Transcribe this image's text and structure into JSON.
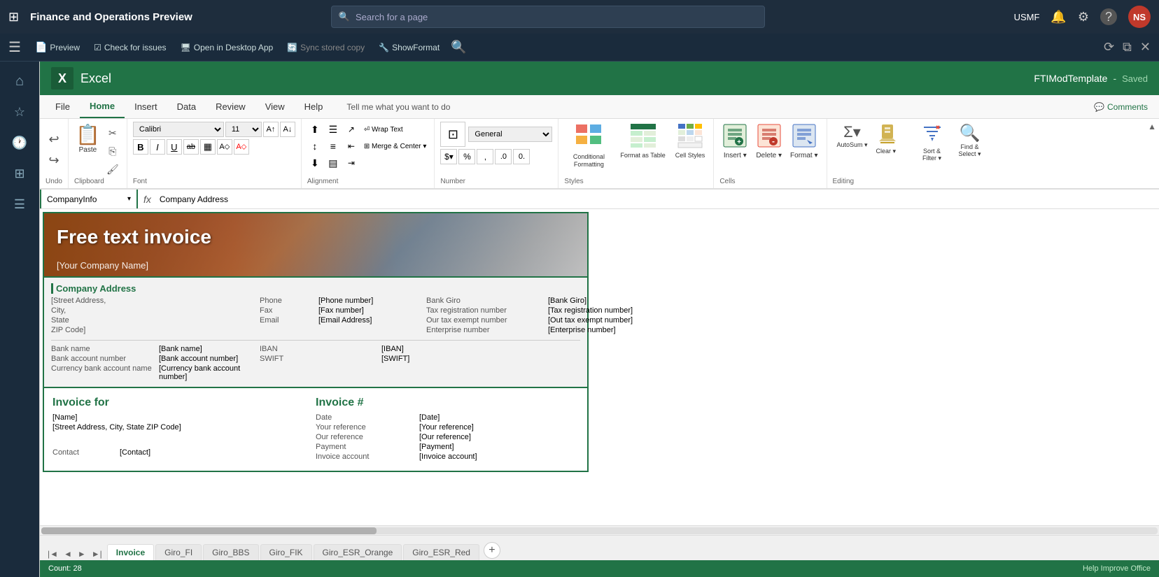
{
  "topNav": {
    "gridIcon": "⊞",
    "title": "Finance and Operations Preview",
    "search": {
      "placeholder": "Search for a page",
      "icon": "🔍"
    },
    "userRegion": "USMF",
    "icons": {
      "bell": "🔔",
      "gear": "⚙",
      "help": "?",
      "avatar": "NS"
    }
  },
  "appToolbar": {
    "preview": "Preview",
    "checkIssues": "Check for issues",
    "openDesktop": "Open in Desktop App",
    "syncCopy": "Sync stored copy",
    "showFormat": "ShowFormat",
    "searchIcon": "🔍"
  },
  "excel": {
    "logo": "X",
    "appName": "Excel",
    "fileName": "FTIModTemplate",
    "separator": "-",
    "savedStatus": "Saved"
  },
  "ribbon": {
    "tabs": [
      "File",
      "Home",
      "Insert",
      "Data",
      "Review",
      "View",
      "Help"
    ],
    "activeTab": "Home",
    "tellMe": "Tell me what you want to do",
    "comments": "Comments",
    "groups": {
      "undo": {
        "label": "Undo",
        "redo": "Redo"
      },
      "clipboard": {
        "label": "Clipboard",
        "paste": "Paste"
      },
      "font": {
        "label": "Font",
        "fontName": "Calibri",
        "fontSize": "11",
        "bold": "B",
        "italic": "I",
        "underline": "U",
        "strikethrough": "ab",
        "increase": "A↑",
        "decrease": "A↓"
      },
      "alignment": {
        "label": "Alignment"
      },
      "number": {
        "label": "Number",
        "format": "General"
      },
      "styles": {
        "label": "Styles",
        "conditional": "Conditional Formatting",
        "formatTable": "Format as Table",
        "cellStyles": "Cell Styles"
      },
      "cells": {
        "label": "Cells",
        "insert": "Insert",
        "delete": "Delete",
        "format": "Format"
      },
      "editing": {
        "label": "Editing",
        "autoSum": "AutoSum",
        "clear": "Clear",
        "sort": "Sort & Filter",
        "find": "Find & Select"
      }
    }
  },
  "formulaBar": {
    "nameBox": "CompanyInfo",
    "formula": "Company Address"
  },
  "invoiceContent": {
    "title": "Free text invoice",
    "companyPlaceholder": "[Your Company Name]",
    "companyInfoTitle": "Company Address",
    "fields": {
      "streetAddress": "[Street Address,",
      "city": "City,",
      "state": "State",
      "zipCode": "ZIP Code]",
      "phone": "Phone",
      "phoneValue": "[Phone number]",
      "fax": "Fax",
      "faxValue": "[Fax number]",
      "email": "Email",
      "emailValue": "[Email Address]",
      "bankGiro": "Bank Giro",
      "bankGiroValue": "[Bank Giro]",
      "taxReg": "Tax registration number",
      "taxRegValue": "[Tax registration number]",
      "taxExempt": "Our tax exempt number",
      "taxExemptValue": "[Out tax exempt number]",
      "enterpriseNum": "Enterprise number",
      "enterpriseNumValue": "[Enterprise number]",
      "bankName": "Bank name",
      "bankNameValue": "[Bank name]",
      "bankAccount": "Bank account number",
      "bankAccountValue": "[Bank account number]",
      "bankCurrency": "Currency bank account name",
      "bankCurrencyValue": "[Currency bank account number]",
      "iban": "IBAN",
      "ibanValue": "[IBAN]",
      "swift": "SWIFT",
      "swiftValue": "[SWIFT]"
    },
    "invoiceFor": {
      "title": "Invoice for",
      "name": "[Name]",
      "address": "[Street Address, City, State ZIP Code]",
      "contact": "Contact",
      "contactValue": "[Contact]"
    },
    "invoiceNum": {
      "title": "Invoice #",
      "date": "Date",
      "dateValue": "[Date]",
      "yourRef": "Your reference",
      "yourRefValue": "[Your reference]",
      "ourRef": "Our reference",
      "ourRefValue": "[Our reference]",
      "payment": "Payment",
      "paymentValue": "[Payment]",
      "invoiceAccount": "Invoice account",
      "invoiceAccountValue": "[Invoice account]"
    }
  },
  "sheetTabs": {
    "sheets": [
      "Invoice",
      "Giro_FI",
      "Giro_BBS",
      "Giro_FIK",
      "Giro_ESR_Orange",
      "Giro_ESR_Red"
    ],
    "activeSheet": "Invoice"
  },
  "statusBar": {
    "count": "Count: 28",
    "improveOffice": "Help Improve Office"
  }
}
